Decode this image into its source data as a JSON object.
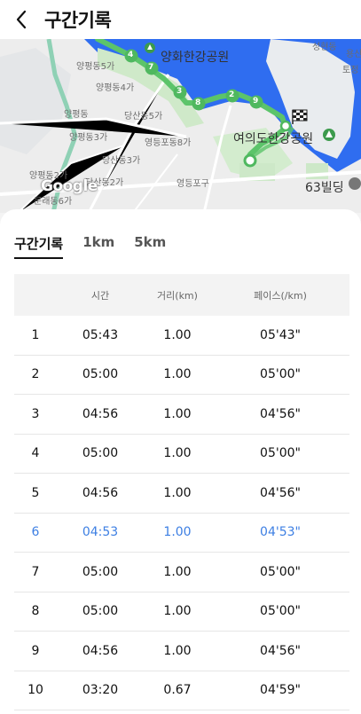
{
  "header": {
    "title": "구간기록"
  },
  "map": {
    "labels": {
      "yanghwa_park": "양화한강공원",
      "yeouido_park": "여의도한강공원",
      "building63": "63빌딩",
      "yangpyeong5": "양평동5가",
      "yangpyeong4": "양평동4가",
      "yangpyeong": "양평동",
      "yangpyeong3": "양평동3가",
      "dangsan5": "당산동5가",
      "dangsan3": "당산동3가",
      "yeongdeungpo8": "영등포동8가",
      "yangpyeong2": "양평동2가",
      "dangsan2": "당산동2가",
      "mullae6": "문래동6가",
      "yeongdeungpo_market": "영등포구",
      "seonghyeon": "성현동",
      "yong": "용산",
      "topung": "토정"
    },
    "google_logo": "Google",
    "markers": [
      "4",
      "7",
      "3",
      "8",
      "2",
      "9"
    ]
  },
  "tabs": [
    {
      "label": "구간기록",
      "active": true
    },
    {
      "label": "1km",
      "active": false
    },
    {
      "label": "5km",
      "active": false
    }
  ],
  "table": {
    "headers": [
      "",
      "시간",
      "거리(km)",
      "페이스(/km)"
    ],
    "rows": [
      {
        "num": "1",
        "time": "05:43",
        "distance": "1.00",
        "pace": "05'43\"",
        "highlight": false
      },
      {
        "num": "2",
        "time": "05:00",
        "distance": "1.00",
        "pace": "05'00\"",
        "highlight": false
      },
      {
        "num": "3",
        "time": "04:56",
        "distance": "1.00",
        "pace": "04'56\"",
        "highlight": false
      },
      {
        "num": "4",
        "time": "05:00",
        "distance": "1.00",
        "pace": "05'00\"",
        "highlight": false
      },
      {
        "num": "5",
        "time": "04:56",
        "distance": "1.00",
        "pace": "04'56\"",
        "highlight": false
      },
      {
        "num": "6",
        "time": "04:53",
        "distance": "1.00",
        "pace": "04'53\"",
        "highlight": true
      },
      {
        "num": "7",
        "time": "05:00",
        "distance": "1.00",
        "pace": "05'00\"",
        "highlight": false
      },
      {
        "num": "8",
        "time": "05:00",
        "distance": "1.00",
        "pace": "05'00\"",
        "highlight": false
      },
      {
        "num": "9",
        "time": "04:56",
        "distance": "1.00",
        "pace": "04'56\"",
        "highlight": false
      },
      {
        "num": "10",
        "time": "03:20",
        "distance": "0.67",
        "pace": "04'59\"",
        "highlight": false
      }
    ]
  },
  "colors": {
    "route": "#5cc46a",
    "water": "#2f6df0",
    "highlight": "#3d7fe3"
  }
}
